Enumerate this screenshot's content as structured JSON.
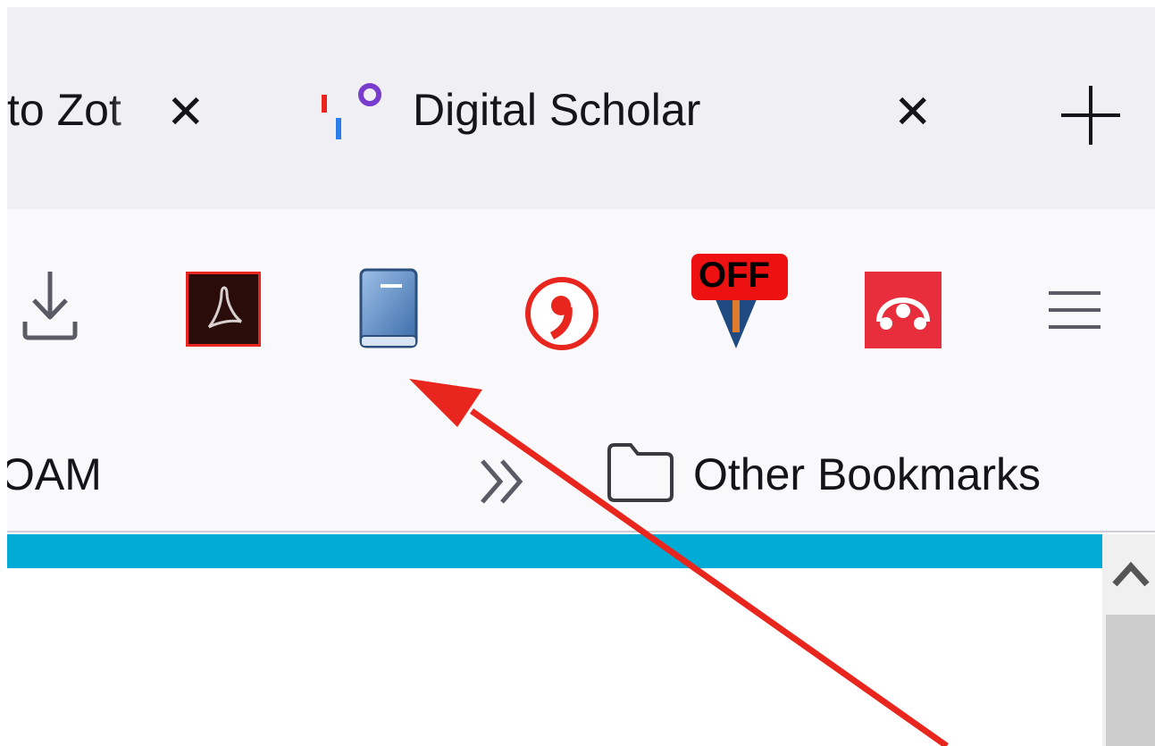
{
  "tabs": [
    {
      "title": "to Zot",
      "active": false
    },
    {
      "title": "Digital Scholar",
      "active": true
    }
  ],
  "toolbar": {
    "icons": [
      "download-icon",
      "adobe-acrobat-icon",
      "blue-book-icon",
      "red-quote-icon",
      "off-badge-icon",
      "mendeley-icon",
      "hamburger-menu-icon"
    ],
    "off_badge_text": "OFF"
  },
  "bookmarks": {
    "left_item": "OAM",
    "other": "Other Bookmarks"
  },
  "colors": {
    "accent_bar": "#00acd6",
    "annotation_arrow": "#e8261d"
  }
}
